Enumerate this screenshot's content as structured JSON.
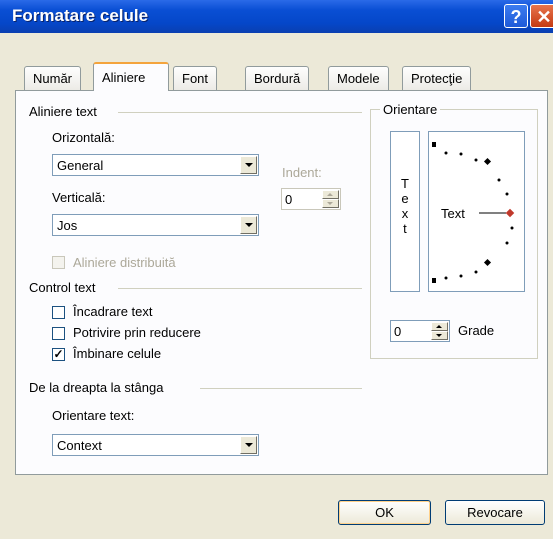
{
  "window": {
    "title": "Formatare celule",
    "help_glyph": "?",
    "close_glyph": "✕"
  },
  "tabs": [
    {
      "label": "Număr"
    },
    {
      "label": "Aliniere"
    },
    {
      "label": "Font"
    },
    {
      "label": "Bordură"
    },
    {
      "label": "Modele"
    },
    {
      "label": "Protecţie"
    }
  ],
  "alignment": {
    "group_label": "Aliniere text",
    "horizontal_label": "Orizontală:",
    "horizontal_value": "General",
    "vertical_label": "Verticală:",
    "vertical_value": "Jos",
    "indent_label": "Indent:",
    "indent_value": "0",
    "distributed_label": "Aliniere distribuită"
  },
  "text_control": {
    "group_label": "Control text",
    "wrap_label": "Încadrare text",
    "wrap_checked": false,
    "shrink_label": "Potrivire prin reducere",
    "shrink_checked": false,
    "merge_label": "Îmbinare celule",
    "merge_checked": true,
    "check_mark": "✓"
  },
  "rtl": {
    "group_label": "De la dreapta la stânga",
    "direction_label": "Orientare text:",
    "direction_value": "Context"
  },
  "orientation": {
    "group_label": "Orientare",
    "vertical_text": [
      "T",
      "e",
      "x",
      "t"
    ],
    "dial_text": "Text",
    "degrees_value": "0",
    "degrees_label": "Grade",
    "accent_color": "#c0392b"
  },
  "buttons": {
    "ok": "OK",
    "cancel": "Revocare"
  }
}
